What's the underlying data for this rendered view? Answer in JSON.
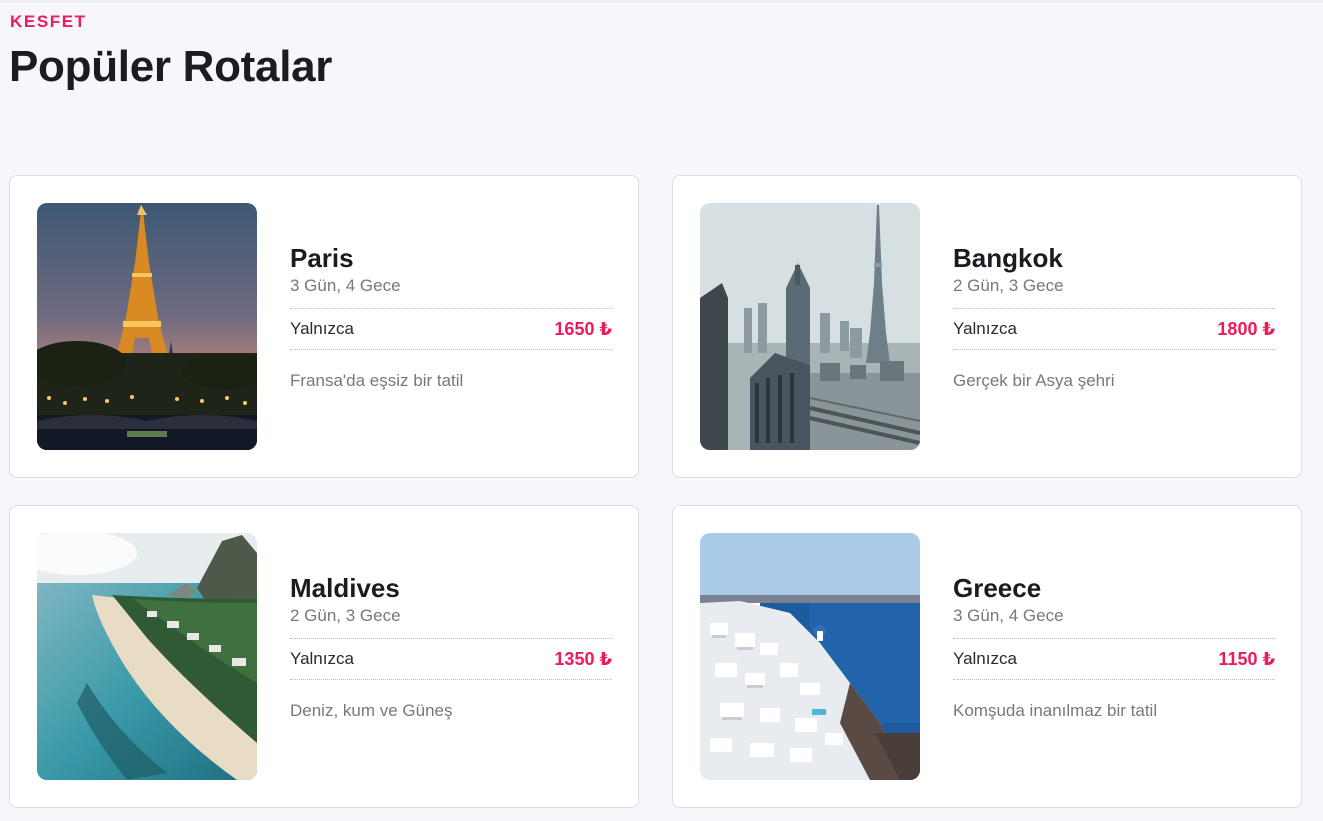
{
  "header": {
    "eyebrow": "KESFET",
    "title": "Popüler Rotalar"
  },
  "routes": [
    {
      "name": "Paris",
      "duration": "3 Gün, 4 Gece",
      "price_label": "Yalnızca",
      "price": "1650 ₺",
      "tagline": "Fransa'da eşsiz bir tatil"
    },
    {
      "name": "Bangkok",
      "duration": "2 Gün, 3 Gece",
      "price_label": "Yalnızca",
      "price": "1800 ₺",
      "tagline": "Gerçek bir Asya şehri"
    },
    {
      "name": "Maldives",
      "duration": "2 Gün, 3 Gece",
      "price_label": "Yalnızca",
      "price": "1350 ₺",
      "tagline": "Deniz, kum ve Güneş"
    },
    {
      "name": "Greece",
      "duration": "3 Gün, 4 Gece",
      "price_label": "Yalnızca",
      "price": "1150 ₺",
      "tagline": "Komşuda inanılmaz bir tatil"
    }
  ],
  "colors": {
    "accent": "#f0195a",
    "background": "#f7f6fb",
    "card": "#ffffff",
    "muted_text": "#77777f"
  }
}
